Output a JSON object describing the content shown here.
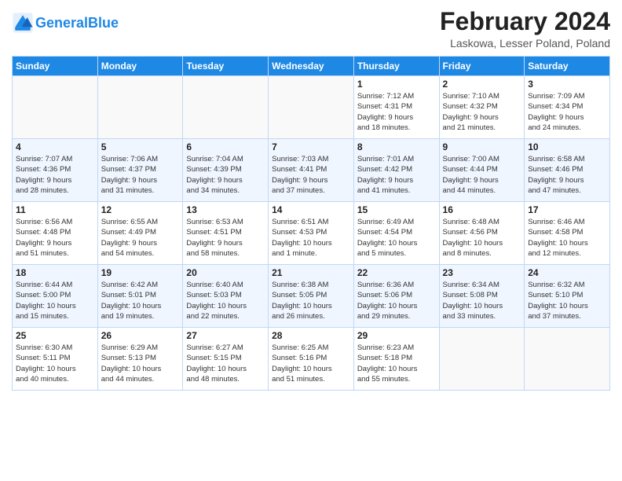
{
  "header": {
    "logo_text_general": "General",
    "logo_text_blue": "Blue",
    "month_year": "February 2024",
    "location": "Laskowa, Lesser Poland, Poland"
  },
  "days_of_week": [
    "Sunday",
    "Monday",
    "Tuesday",
    "Wednesday",
    "Thursday",
    "Friday",
    "Saturday"
  ],
  "weeks": [
    [
      {
        "day": "",
        "info": ""
      },
      {
        "day": "",
        "info": ""
      },
      {
        "day": "",
        "info": ""
      },
      {
        "day": "",
        "info": ""
      },
      {
        "day": "1",
        "info": "Sunrise: 7:12 AM\nSunset: 4:31 PM\nDaylight: 9 hours\nand 18 minutes."
      },
      {
        "day": "2",
        "info": "Sunrise: 7:10 AM\nSunset: 4:32 PM\nDaylight: 9 hours\nand 21 minutes."
      },
      {
        "day": "3",
        "info": "Sunrise: 7:09 AM\nSunset: 4:34 PM\nDaylight: 9 hours\nand 24 minutes."
      }
    ],
    [
      {
        "day": "4",
        "info": "Sunrise: 7:07 AM\nSunset: 4:36 PM\nDaylight: 9 hours\nand 28 minutes."
      },
      {
        "day": "5",
        "info": "Sunrise: 7:06 AM\nSunset: 4:37 PM\nDaylight: 9 hours\nand 31 minutes."
      },
      {
        "day": "6",
        "info": "Sunrise: 7:04 AM\nSunset: 4:39 PM\nDaylight: 9 hours\nand 34 minutes."
      },
      {
        "day": "7",
        "info": "Sunrise: 7:03 AM\nSunset: 4:41 PM\nDaylight: 9 hours\nand 37 minutes."
      },
      {
        "day": "8",
        "info": "Sunrise: 7:01 AM\nSunset: 4:42 PM\nDaylight: 9 hours\nand 41 minutes."
      },
      {
        "day": "9",
        "info": "Sunrise: 7:00 AM\nSunset: 4:44 PM\nDaylight: 9 hours\nand 44 minutes."
      },
      {
        "day": "10",
        "info": "Sunrise: 6:58 AM\nSunset: 4:46 PM\nDaylight: 9 hours\nand 47 minutes."
      }
    ],
    [
      {
        "day": "11",
        "info": "Sunrise: 6:56 AM\nSunset: 4:48 PM\nDaylight: 9 hours\nand 51 minutes."
      },
      {
        "day": "12",
        "info": "Sunrise: 6:55 AM\nSunset: 4:49 PM\nDaylight: 9 hours\nand 54 minutes."
      },
      {
        "day": "13",
        "info": "Sunrise: 6:53 AM\nSunset: 4:51 PM\nDaylight: 9 hours\nand 58 minutes."
      },
      {
        "day": "14",
        "info": "Sunrise: 6:51 AM\nSunset: 4:53 PM\nDaylight: 10 hours\nand 1 minute."
      },
      {
        "day": "15",
        "info": "Sunrise: 6:49 AM\nSunset: 4:54 PM\nDaylight: 10 hours\nand 5 minutes."
      },
      {
        "day": "16",
        "info": "Sunrise: 6:48 AM\nSunset: 4:56 PM\nDaylight: 10 hours\nand 8 minutes."
      },
      {
        "day": "17",
        "info": "Sunrise: 6:46 AM\nSunset: 4:58 PM\nDaylight: 10 hours\nand 12 minutes."
      }
    ],
    [
      {
        "day": "18",
        "info": "Sunrise: 6:44 AM\nSunset: 5:00 PM\nDaylight: 10 hours\nand 15 minutes."
      },
      {
        "day": "19",
        "info": "Sunrise: 6:42 AM\nSunset: 5:01 PM\nDaylight: 10 hours\nand 19 minutes."
      },
      {
        "day": "20",
        "info": "Sunrise: 6:40 AM\nSunset: 5:03 PM\nDaylight: 10 hours\nand 22 minutes."
      },
      {
        "day": "21",
        "info": "Sunrise: 6:38 AM\nSunset: 5:05 PM\nDaylight: 10 hours\nand 26 minutes."
      },
      {
        "day": "22",
        "info": "Sunrise: 6:36 AM\nSunset: 5:06 PM\nDaylight: 10 hours\nand 29 minutes."
      },
      {
        "day": "23",
        "info": "Sunrise: 6:34 AM\nSunset: 5:08 PM\nDaylight: 10 hours\nand 33 minutes."
      },
      {
        "day": "24",
        "info": "Sunrise: 6:32 AM\nSunset: 5:10 PM\nDaylight: 10 hours\nand 37 minutes."
      }
    ],
    [
      {
        "day": "25",
        "info": "Sunrise: 6:30 AM\nSunset: 5:11 PM\nDaylight: 10 hours\nand 40 minutes."
      },
      {
        "day": "26",
        "info": "Sunrise: 6:29 AM\nSunset: 5:13 PM\nDaylight: 10 hours\nand 44 minutes."
      },
      {
        "day": "27",
        "info": "Sunrise: 6:27 AM\nSunset: 5:15 PM\nDaylight: 10 hours\nand 48 minutes."
      },
      {
        "day": "28",
        "info": "Sunrise: 6:25 AM\nSunset: 5:16 PM\nDaylight: 10 hours\nand 51 minutes."
      },
      {
        "day": "29",
        "info": "Sunrise: 6:23 AM\nSunset: 5:18 PM\nDaylight: 10 hours\nand 55 minutes."
      },
      {
        "day": "",
        "info": ""
      },
      {
        "day": "",
        "info": ""
      }
    ]
  ]
}
